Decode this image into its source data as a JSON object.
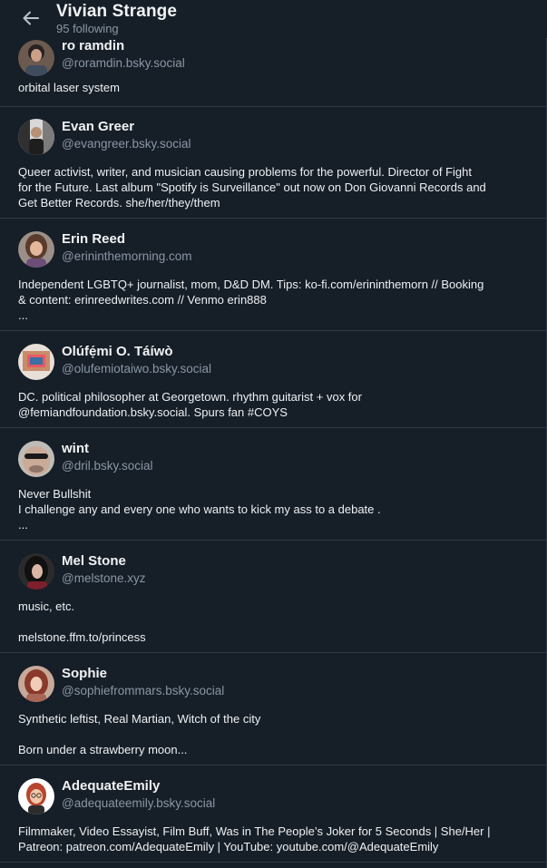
{
  "header": {
    "title": "Vivian Strange",
    "subtitle": "95 following"
  },
  "profiles": [
    {
      "name": "ro ramdin",
      "handle": "@roramdin.bsky.social",
      "bio": [
        "orbital laser system"
      ]
    },
    {
      "name": "Evan Greer",
      "handle": "@evangreer.bsky.social",
      "bio": [
        "Queer activist, writer, and musician causing problems for the powerful. Director of Fight",
        "for the Future. Last album \"Spotify is Surveillance\" out now on Don Giovanni Records and",
        "Get Better Records. she/her/they/them"
      ]
    },
    {
      "name": "Erin Reed",
      "handle": "@erininthemorning.com",
      "bio": [
        "Independent LGBTQ+ journalist, mom, D&D DM. Tips: ko-fi.com/erininthemorn // Booking",
        "& content: erinreedwrites.com // Venmo erin888",
        "..."
      ]
    },
    {
      "name": "Olúfẹ́mi O. Táíwò",
      "handle": "@olufemiotaiwo.bsky.social",
      "bio": [
        "DC. political philosopher at Georgetown. rhythm guitarist + vox for",
        "@femiandfoundation.bsky.social. Spurs fan #COYS"
      ]
    },
    {
      "name": "wint",
      "handle": "@dril.bsky.social",
      "bio": [
        "Never Bullshit",
        "I challenge any and every one who wants to kick my ass to a debate .",
        "..."
      ]
    },
    {
      "name": "Mel Stone",
      "handle": "@melstone.xyz",
      "bio": [
        "music, etc.",
        "",
        "melstone.ffm.to/princess"
      ]
    },
    {
      "name": "Sophie",
      "handle": "@sophiefrommars.bsky.social",
      "bio": [
        "Synthetic leftist, Real Martian, Witch of the city",
        "",
        "Born under a strawberry moon..."
      ]
    },
    {
      "name": "AdequateEmily",
      "handle": "@adequateemily.bsky.social",
      "bio": [
        "Filmmaker, Video Essayist, Film Buff, Was in The People’s Joker for 5 Seconds | She/Her |",
        "Patreon: patreon.com/AdequateEmily | YouTube: youtube.com/@AdequateEmily"
      ]
    }
  ]
}
